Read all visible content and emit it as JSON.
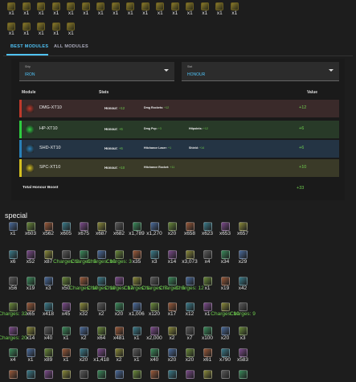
{
  "top_items": {
    "row1": {
      "count": 16,
      "label": "x1"
    },
    "row2": {
      "count": 5,
      "label": "x1"
    }
  },
  "tabs": [
    {
      "label": "BEST MODULES",
      "active": true
    },
    {
      "label": "ALL MODULES",
      "active": false
    }
  ],
  "filters": {
    "ship": {
      "label": "Ship",
      "value": "IRON"
    },
    "stat": {
      "label": "Stat",
      "value": "HONOUR"
    }
  },
  "table": {
    "headers": {
      "module": "Module",
      "stats": "Stats",
      "value": "Value"
    },
    "rows": [
      {
        "name": "DMG-XT10",
        "bg": "#3a2a2a",
        "accent": "#c0392b",
        "icon": "#c0392b",
        "honour": "+12",
        "stats": [
          {
            "label": "Dmg Rockets:",
            "value": "+12"
          }
        ],
        "value": "+12"
      },
      {
        "name": "HP-XT10",
        "bg": "#283a28",
        "accent": "#2ecc40",
        "icon": "#2ecc40",
        "honour": "+6",
        "stats": [
          {
            "label": "Dmg Pvp:",
            "value": "+3"
          },
          {
            "label": "Hitpoints:",
            "value": "+12"
          }
        ],
        "value": "+6"
      },
      {
        "name": "SHD-XT10",
        "bg": "#243444",
        "accent": "#2980b9",
        "icon": "#2980b9",
        "honour": "+6",
        "stats": [
          {
            "label": "Hitchance Laser:",
            "value": "+1"
          },
          {
            "label": "Shield:",
            "value": "+14"
          }
        ],
        "value": "+6"
      },
      {
        "name": "SPC-XT10",
        "bg": "#3a3a28",
        "accent": "#d4c020",
        "icon": "#d4c020",
        "honour": "+10",
        "stats": [
          {
            "label": "Hitchance Rocket:",
            "value": "+11"
          }
        ],
        "value": "+10"
      }
    ],
    "honour_label": "Honour:",
    "total_label": "Total Honour Boost",
    "total_value": "+33"
  },
  "special": {
    "title": "special",
    "rows": [
      [
        "x1",
        "x603",
        "x562",
        "x605",
        "x675",
        "x687",
        "x682",
        "x1,789",
        "x1,270",
        "x20",
        "x658",
        "x623",
        "x653",
        "x657"
      ],
      [
        "x6",
        "x52",
        "x87",
        "Charges: 2",
        "Charges: 5",
        "Charges: 10",
        "Charges: 3",
        "x35",
        "x3",
        "x14",
        "x3,073",
        "x4",
        "x34",
        "x29"
      ],
      [
        "x56",
        "x19",
        "x3",
        "x50",
        "Charges: 10",
        "Charges: 19",
        "Charges: 17",
        "Charges: 1",
        "Charges: 7",
        "Charges: 5",
        "Charges: 12",
        "x1",
        "x19",
        "x42"
      ],
      [
        "Charges: 32",
        "x65",
        "x418",
        "x45",
        "x32",
        "x2",
        "x20",
        "x1,006",
        "x120",
        "x17",
        "x12",
        "x1",
        "Charges: 10",
        "Charges: 9"
      ],
      [
        "Charges: 20",
        "x14",
        "x40",
        "x1",
        "x2",
        "x64",
        "x481",
        "x1",
        "x2,000",
        "x2",
        "x7",
        "x100",
        "x20",
        "x3"
      ],
      [
        "x4",
        "x1",
        "x89",
        "x1",
        "x20",
        "x1,418",
        "x2",
        "x1",
        "x40",
        "x20",
        "x20",
        "x61",
        "x790",
        "x583"
      ],
      [
        "",
        "",
        "",
        "",
        "",
        "",
        "",
        "",
        "",
        "",
        "",
        "",
        "",
        ""
      ]
    ]
  },
  "colors": {
    "accent": "#4fc3f7",
    "green": "#6fcf4f"
  }
}
